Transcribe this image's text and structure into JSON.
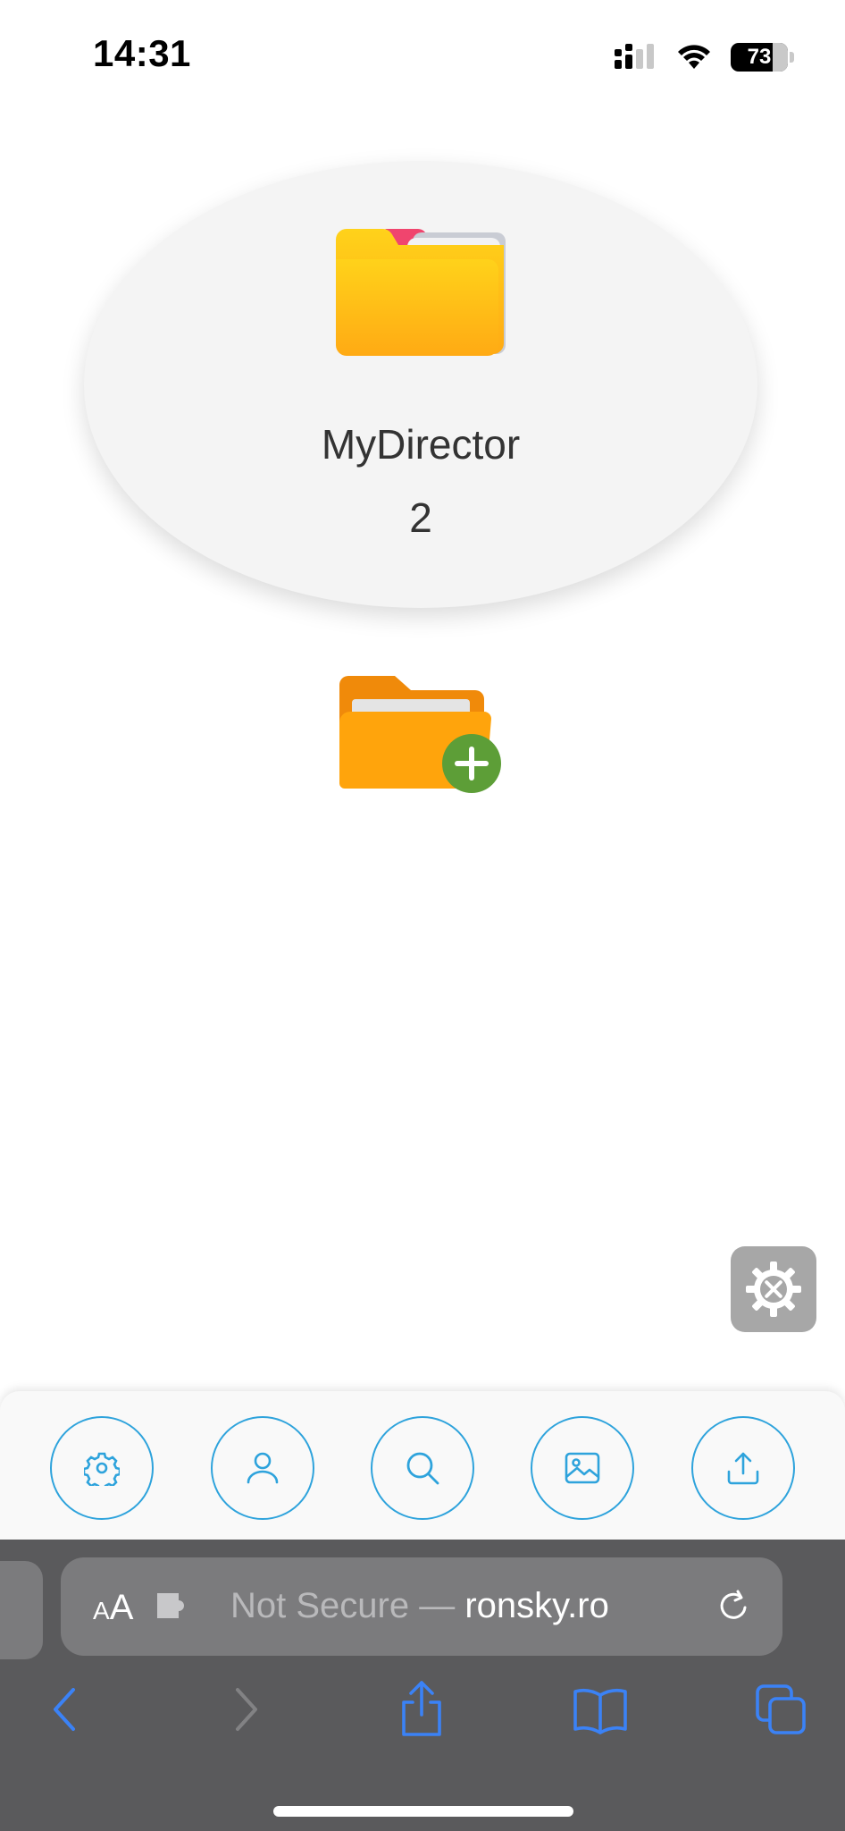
{
  "status_bar": {
    "time": "14:31",
    "battery_level": "73"
  },
  "folder": {
    "name": "MyDirector",
    "count": "2",
    "icon": "folder-icon"
  },
  "add_folder": {
    "icon": "folder-add-icon"
  },
  "tools": {
    "icon": "settings-tools-icon"
  },
  "toolbar": {
    "items": [
      {
        "icon": "gear-icon"
      },
      {
        "icon": "user-icon"
      },
      {
        "icon": "search-icon"
      },
      {
        "icon": "image-icon"
      },
      {
        "icon": "upload-icon"
      }
    ],
    "accent": "#2ea3dc"
  },
  "browser": {
    "aa_label": "AA",
    "url_prefix": "Not Secure — ",
    "domain": "ronsky.ro",
    "accent": "#3b82f6"
  }
}
